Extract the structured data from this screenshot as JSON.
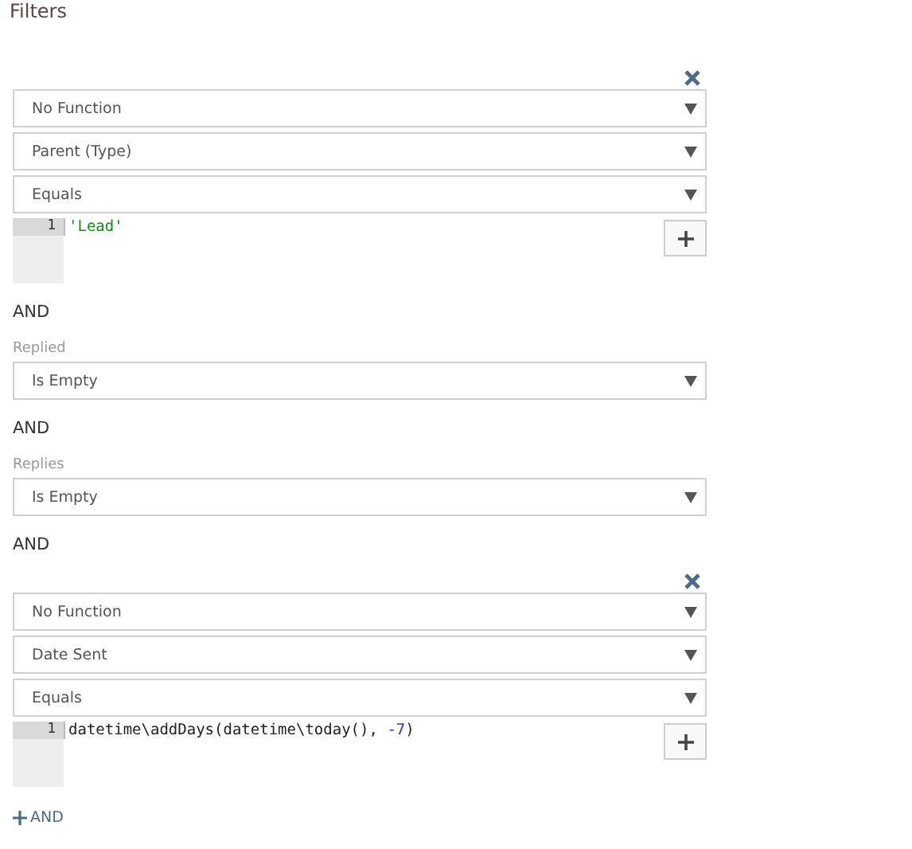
{
  "title": "Filters",
  "items": [
    {
      "kind": "expression",
      "selects": [
        "No Function",
        "Parent (Type)",
        "Equals"
      ],
      "line_number": "1",
      "code": [
        {
          "kind": "string",
          "text": "'Lead'"
        }
      ]
    },
    {
      "kind": "joiner",
      "text": "AND"
    },
    {
      "kind": "field",
      "label": "Replied",
      "select": "Is Empty"
    },
    {
      "kind": "joiner",
      "text": "AND"
    },
    {
      "kind": "field",
      "label": "Replies",
      "select": "Is Empty"
    },
    {
      "kind": "joiner",
      "text": "AND"
    },
    {
      "kind": "expression",
      "selects": [
        "No Function",
        "Date Sent",
        "Equals"
      ],
      "line_number": "1",
      "code": [
        {
          "kind": "plain",
          "text": "datetime\\addDays(datetime\\today(), "
        },
        {
          "kind": "number",
          "text": "-7"
        },
        {
          "kind": "plain",
          "text": ")"
        }
      ]
    }
  ],
  "add_link": "AND"
}
